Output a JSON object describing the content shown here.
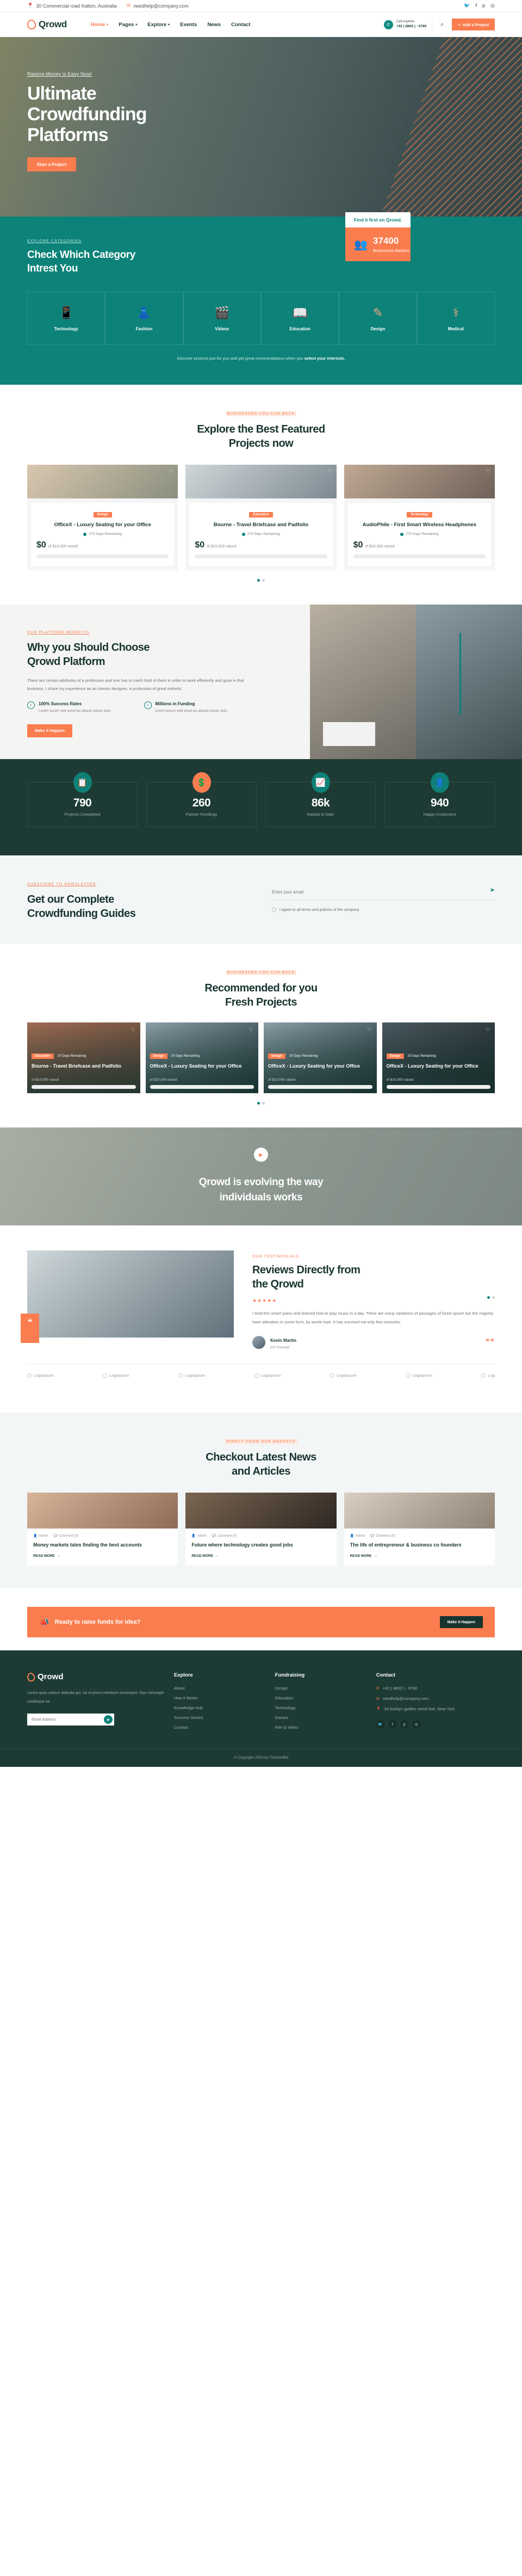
{
  "topbar": {
    "address": "30 Commercial road fratton, Australia",
    "email": "needhelp@company.com",
    "social": [
      "twitter-icon",
      "facebook-icon",
      "pinterest-icon",
      "instagram-icon"
    ]
  },
  "nav": {
    "brand": "Qrowd",
    "items": [
      {
        "label": "Home",
        "caret": "▾",
        "active": true
      },
      {
        "label": "Pages",
        "caret": "▾",
        "active": false
      },
      {
        "label": "Explore",
        "caret": "▾",
        "active": false
      },
      {
        "label": "Events",
        "caret": "",
        "active": false
      },
      {
        "label": "News",
        "caret": "",
        "active": false
      },
      {
        "label": "Contact",
        "caret": "",
        "active": false
      }
    ],
    "call_label": "Call Anytime",
    "call_number": "+92 ( 8800 ) - 6780",
    "cta": "Add a Project"
  },
  "hero": {
    "eyebrow": "Raising Money is Easy Now!",
    "title_line1": "Ultimate",
    "title_line2": "Crowdfunding",
    "title_line3": "Platforms",
    "cta": "Start a Project"
  },
  "findit": {
    "label": "Find it first on Qrowd.",
    "count": "37400",
    "count_label": "Businesses Backers"
  },
  "categories": {
    "eyebrow": "EXPLORE CATEGORIES",
    "title_line1": "Check Which Category",
    "title_line2": "Intrest You",
    "items": [
      {
        "label": "Technology",
        "icon": "mobile-globe-icon"
      },
      {
        "label": "Fashion",
        "icon": "fashion-icon"
      },
      {
        "label": "Videos",
        "icon": "video-clapper-icon"
      },
      {
        "label": "Education",
        "icon": "book-icon"
      },
      {
        "label": "Design",
        "icon": "design-tools-icon"
      },
      {
        "label": "Medical",
        "icon": "medical-icon"
      }
    ],
    "note_plain": "Discover projects just for you and get great recomendations when you ",
    "note_bold": "select your interests."
  },
  "featured": {
    "eyebrow": "BUSINESSES YOU CAN BACK",
    "title_line1": "Explore the Best Featured",
    "title_line2": "Projects now",
    "cards": [
      {
        "tag": "Design",
        "title": "OfficeX - Luxury Seating for your Office",
        "time": "275 Days Remaining",
        "amount": "$0",
        "goal": "of $10,000 raised"
      },
      {
        "tag": "Education",
        "title": "Bourne - Travel Briefcase and Padfolio",
        "time": "275 Days Remaining",
        "amount": "$0",
        "goal": "of $10,000 raised"
      },
      {
        "tag": "Technology",
        "title": "AudioPhile - First Smart Wireless Headphones",
        "time": "275 Days Remaining",
        "amount": "$0",
        "goal": "of $10,000 raised"
      }
    ]
  },
  "why": {
    "eyebrow": "OUR PLATFORM BENEFITS",
    "title_line1": "Why you Should Choose",
    "title_line2": "Qrowd Platform",
    "lead": "There are certain attributes of a profession and one has to catch hold of them in order to work efficiently and grow in that business. I share my experience as an interior designer, a profession of great esthetic.",
    "features": [
      {
        "title": "100% Success Rates",
        "text": "Lorem ipsum velit anod ips aliquet enean quis."
      },
      {
        "title": "Millions in Funding",
        "text": "Lorem ipsum velit anod ips aliquet enean quis."
      }
    ],
    "cta": "Make it Happen"
  },
  "counters": {
    "items": [
      {
        "value": "790",
        "label": "Projects Completed",
        "icon": "document-check-icon",
        "accent": false
      },
      {
        "value": "260",
        "label": "Partner Fundings",
        "icon": "handshake-dollar-icon",
        "accent": true
      },
      {
        "value": "86k",
        "label": "Raised to Date",
        "icon": "growth-icon",
        "accent": false
      },
      {
        "value": "940",
        "label": "Happy Customers",
        "icon": "people-icon",
        "accent": false
      }
    ]
  },
  "newsletter": {
    "eyebrow": "SUBSCRIBE TO NEWSLETTER",
    "title_line1": "Get our Complete",
    "title_line2": "Crowdfunding Guides",
    "placeholder": "Enter your email",
    "agree": "I agree to all terms and policies of the company",
    "send_icon": "send-icon"
  },
  "recommended": {
    "eyebrow": "BUSINESSES YOU CAN BACK",
    "title_line1": "Recommended for you",
    "title_line2": "Fresh Projects",
    "cards": [
      {
        "tag": "Education",
        "time": "20 Days Remaining",
        "title": "Bourne - Travel Briefcase and Padfolio",
        "goal": "of $10,000 raised"
      },
      {
        "tag": "Design",
        "time": "20 Days Remaining",
        "title": "OfficeX - Luxury Seating for your Office",
        "goal": "of $10,000 raised"
      },
      {
        "tag": "Design",
        "time": "20 Days Remaining",
        "title": "OfficeX - Luxury Seating for your Office",
        "goal": "of $10,000 raised"
      },
      {
        "tag": "Design",
        "time": "20 Days Remaining",
        "title": "OfficeX - Luxury Seating for your Office",
        "goal": "of $10,000 raised"
      }
    ]
  },
  "video": {
    "play_icon": "play-icon",
    "title_line1": "Qrowd is evolving the way",
    "title_line2": "individuals works"
  },
  "testimonials": {
    "eyebrow": "OUR TESTIMONIALS",
    "title_line1": "Reviews Directly from",
    "title_line2": "the Qrowd",
    "stars": "★★★★★",
    "body": "I tried this smart piano and learned how to play music in a day. There are many variations of passages of lorem ipsum but the majority have alteration in some form, by words look. It has survived not only five centuries.",
    "author": "Kevin Martin",
    "role": "CO Founder"
  },
  "logos": [
    {
      "label": "Logoipsum"
    },
    {
      "label": "Logoipsum"
    },
    {
      "label": "Logoipsum"
    },
    {
      "label": "Logoipsum"
    },
    {
      "label": "Logoipsum"
    },
    {
      "label": "Logoipsum"
    },
    {
      "label": "Log"
    }
  ],
  "blog": {
    "eyebrow": "DIRECT FROM OUR MARKETS",
    "title_line1": "Checkout Latest News",
    "title_line2": "and Articles",
    "cards": [
      {
        "author": "Admin",
        "comments": "Comment (0)",
        "title": "Money markets tales finding the best accounts",
        "more": "READ MORE"
      },
      {
        "author": "Admin",
        "comments": "Comment (0)",
        "title": "Future where technology creates good jobs",
        "more": "READ MORE"
      },
      {
        "author": "Admin",
        "comments": "Comment (0)",
        "title": "The life of entrepreneur & business co founders",
        "more": "READ MORE"
      }
    ]
  },
  "cta": {
    "icon": "megaphone-icon",
    "text": "Ready to raise funds for idea?",
    "button": "Make it Happen"
  },
  "footer": {
    "brand": "Qrowd",
    "desc": "Lorem quas utamur delicata qui, vix ei primo mentitum omnesque. Duo corrumpit cotidieque ne.",
    "email_placeholder": "Email Address",
    "cols": [
      {
        "title": "Explore",
        "links": [
          "About",
          "How it Works",
          "Knowledge Hub",
          "Success Stories",
          "Contact"
        ]
      },
      {
        "title": "Fundraising",
        "links": [
          "Design",
          "Education",
          "Technology",
          "Games",
          "Film & Video"
        ]
      }
    ],
    "contact_title": "Contact",
    "contact": [
      {
        "icon": "phone-icon",
        "text": "+92 ( 8800 ) - 6780"
      },
      {
        "icon": "mail-icon",
        "text": "needhelp@company.com"
      },
      {
        "icon": "pin-icon",
        "text": "30 broklyn golden street line, New York"
      }
    ],
    "social": [
      "twitter-icon",
      "facebook-icon",
      "pinterest-icon",
      "instagram-icon"
    ],
    "copyright": "© Copyright 2023 by Themesflat"
  }
}
